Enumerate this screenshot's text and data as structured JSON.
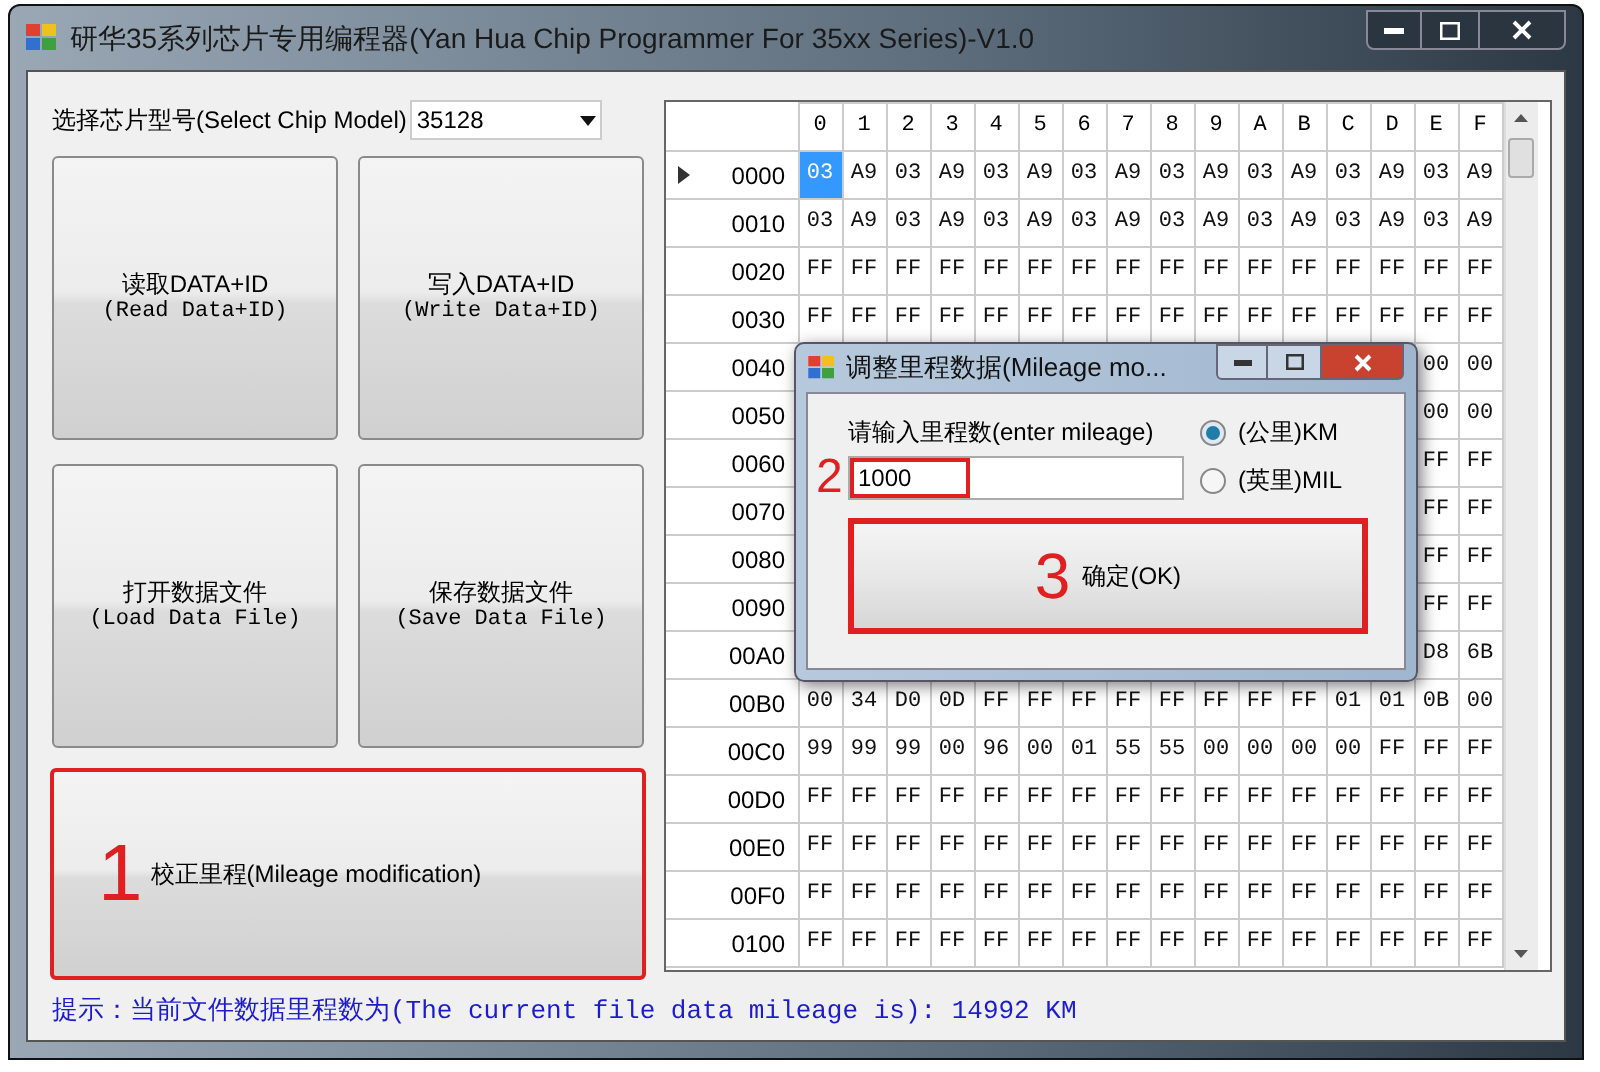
{
  "window": {
    "title": "研华35系列芯片专用编程器(Yan Hua Chip Programmer For 35xx Series)-V1.0"
  },
  "chip_select": {
    "label": "选择芯片型号(Select Chip Model)",
    "value": "35128"
  },
  "buttons": [
    {
      "label": "读取DATA+ID",
      "sublabel": "(Read Data+ID)",
      "highlighted": false
    },
    {
      "label": "写入DATA+ID",
      "sublabel": "(Write Data+ID)",
      "highlighted": false
    },
    {
      "label": "打开数据文件",
      "sublabel": "(Load Data File)",
      "highlighted": false
    },
    {
      "label": "保存数据文件",
      "sublabel": "(Save Data File)",
      "highlighted": false
    }
  ],
  "mileage_button": {
    "step": "1",
    "label": "校正里程(Mileage modification)",
    "highlighted": true
  },
  "status": "提示：当前文件数据里程数为(The current file data mileage is): 14992 KM",
  "hex_grid": {
    "columns": [
      "0",
      "1",
      "2",
      "3",
      "4",
      "5",
      "6",
      "7",
      "8",
      "9",
      "A",
      "B",
      "C",
      "D",
      "E",
      "F"
    ],
    "rows": [
      {
        "address": "0000",
        "selected": true,
        "cells": [
          {
            "text": "03",
            "selected": true
          },
          {
            "text": "A9",
            "selected": false
          },
          {
            "text": "03",
            "selected": false
          },
          {
            "text": "A9",
            "selected": false
          },
          {
            "text": "03",
            "selected": false
          },
          {
            "text": "A9",
            "selected": false
          },
          {
            "text": "03",
            "selected": false
          },
          {
            "text": "A9",
            "selected": false
          },
          {
            "text": "03",
            "selected": false
          },
          {
            "text": "A9",
            "selected": false
          },
          {
            "text": "03",
            "selected": false
          },
          {
            "text": "A9",
            "selected": false
          },
          {
            "text": "03",
            "selected": false
          },
          {
            "text": "A9",
            "selected": false
          },
          {
            "text": "03",
            "selected": false
          },
          {
            "text": "A9",
            "selected": false
          }
        ]
      },
      {
        "address": "0010",
        "selected": false,
        "cells": [
          {
            "text": "03",
            "selected": false
          },
          {
            "text": "A9",
            "selected": false
          },
          {
            "text": "03",
            "selected": false
          },
          {
            "text": "A9",
            "selected": false
          },
          {
            "text": "03",
            "selected": false
          },
          {
            "text": "A9",
            "selected": false
          },
          {
            "text": "03",
            "selected": false
          },
          {
            "text": "A9",
            "selected": false
          },
          {
            "text": "03",
            "selected": false
          },
          {
            "text": "A9",
            "selected": false
          },
          {
            "text": "03",
            "selected": false
          },
          {
            "text": "A9",
            "selected": false
          },
          {
            "text": "03",
            "selected": false
          },
          {
            "text": "A9",
            "selected": false
          },
          {
            "text": "03",
            "selected": false
          },
          {
            "text": "A9",
            "selected": false
          }
        ]
      },
      {
        "address": "0020",
        "selected": false,
        "cells": [
          {
            "text": "FF",
            "selected": false
          },
          {
            "text": "FF",
            "selected": false
          },
          {
            "text": "FF",
            "selected": false
          },
          {
            "text": "FF",
            "selected": false
          },
          {
            "text": "FF",
            "selected": false
          },
          {
            "text": "FF",
            "selected": false
          },
          {
            "text": "FF",
            "selected": false
          },
          {
            "text": "FF",
            "selected": false
          },
          {
            "text": "FF",
            "selected": false
          },
          {
            "text": "FF",
            "selected": false
          },
          {
            "text": "FF",
            "selected": false
          },
          {
            "text": "FF",
            "selected": false
          },
          {
            "text": "FF",
            "selected": false
          },
          {
            "text": "FF",
            "selected": false
          },
          {
            "text": "FF",
            "selected": false
          },
          {
            "text": "FF",
            "selected": false
          }
        ]
      },
      {
        "address": "0030",
        "selected": false,
        "cells": [
          {
            "text": "FF",
            "selected": false
          },
          {
            "text": "FF",
            "selected": false
          },
          {
            "text": "FF",
            "selected": false
          },
          {
            "text": "FF",
            "selected": false
          },
          {
            "text": "FF",
            "selected": false
          },
          {
            "text": "FF",
            "selected": false
          },
          {
            "text": "FF",
            "selected": false
          },
          {
            "text": "FF",
            "selected": false
          },
          {
            "text": "FF",
            "selected": false
          },
          {
            "text": "FF",
            "selected": false
          },
          {
            "text": "FF",
            "selected": false
          },
          {
            "text": "FF",
            "selected": false
          },
          {
            "text": "FF",
            "selected": false
          },
          {
            "text": "FF",
            "selected": false
          },
          {
            "text": "FF",
            "selected": false
          },
          {
            "text": "FF",
            "selected": false
          }
        ]
      },
      {
        "address": "0040",
        "selected": false,
        "cells": [
          null,
          null,
          null,
          null,
          null,
          null,
          null,
          null,
          null,
          null,
          null,
          null,
          null,
          null,
          {
            "text": "00",
            "selected": false
          },
          {
            "text": "00",
            "selected": false
          }
        ]
      },
      {
        "address": "0050",
        "selected": false,
        "cells": [
          null,
          null,
          null,
          null,
          null,
          null,
          null,
          null,
          null,
          null,
          null,
          null,
          null,
          null,
          {
            "text": "00",
            "selected": false
          },
          {
            "text": "00",
            "selected": false
          }
        ]
      },
      {
        "address": "0060",
        "selected": false,
        "cells": [
          null,
          null,
          null,
          null,
          null,
          null,
          null,
          null,
          null,
          null,
          null,
          null,
          null,
          null,
          {
            "text": "FF",
            "selected": false
          },
          {
            "text": "FF",
            "selected": false
          }
        ]
      },
      {
        "address": "0070",
        "selected": false,
        "cells": [
          null,
          null,
          null,
          null,
          null,
          null,
          null,
          null,
          null,
          null,
          null,
          null,
          null,
          null,
          {
            "text": "FF",
            "selected": false
          },
          {
            "text": "FF",
            "selected": false
          }
        ]
      },
      {
        "address": "0080",
        "selected": false,
        "cells": [
          null,
          null,
          null,
          null,
          null,
          null,
          null,
          null,
          null,
          null,
          null,
          null,
          null,
          null,
          {
            "text": "FF",
            "selected": false
          },
          {
            "text": "FF",
            "selected": false
          }
        ]
      },
      {
        "address": "0090",
        "selected": false,
        "cells": [
          null,
          null,
          null,
          null,
          null,
          null,
          null,
          null,
          null,
          null,
          null,
          null,
          null,
          null,
          {
            "text": "FF",
            "selected": false
          },
          {
            "text": "FF",
            "selected": false
          }
        ]
      },
      {
        "address": "00A0",
        "selected": false,
        "cells": [
          null,
          null,
          null,
          null,
          null,
          null,
          null,
          null,
          null,
          null,
          null,
          null,
          null,
          null,
          {
            "text": "D8",
            "selected": false
          },
          {
            "text": "6B",
            "selected": false
          }
        ]
      },
      {
        "address": "00B0",
        "selected": false,
        "cells": [
          {
            "text": "00",
            "selected": false
          },
          {
            "text": "34",
            "selected": false
          },
          {
            "text": "D0",
            "selected": false
          },
          {
            "text": "0D",
            "selected": false
          },
          {
            "text": "FF",
            "selected": false
          },
          {
            "text": "FF",
            "selected": false
          },
          {
            "text": "FF",
            "selected": false
          },
          {
            "text": "FF",
            "selected": false
          },
          {
            "text": "FF",
            "selected": false
          },
          {
            "text": "FF",
            "selected": false
          },
          {
            "text": "FF",
            "selected": false
          },
          {
            "text": "FF",
            "selected": false
          },
          {
            "text": "01",
            "selected": false
          },
          {
            "text": "01",
            "selected": false
          },
          {
            "text": "0B",
            "selected": false
          },
          {
            "text": "00",
            "selected": false
          }
        ]
      },
      {
        "address": "00C0",
        "selected": false,
        "cells": [
          {
            "text": "99",
            "selected": false
          },
          {
            "text": "99",
            "selected": false
          },
          {
            "text": "99",
            "selected": false
          },
          {
            "text": "00",
            "selected": false
          },
          {
            "text": "96",
            "selected": false
          },
          {
            "text": "00",
            "selected": false
          },
          {
            "text": "01",
            "selected": false
          },
          {
            "text": "55",
            "selected": false
          },
          {
            "text": "55",
            "selected": false
          },
          {
            "text": "00",
            "selected": false
          },
          {
            "text": "00",
            "selected": false
          },
          {
            "text": "00",
            "selected": false
          },
          {
            "text": "00",
            "selected": false
          },
          {
            "text": "FF",
            "selected": false
          },
          {
            "text": "FF",
            "selected": false
          },
          {
            "text": "FF",
            "selected": false
          }
        ]
      },
      {
        "address": "00D0",
        "selected": false,
        "cells": [
          {
            "text": "FF",
            "selected": false
          },
          {
            "text": "FF",
            "selected": false
          },
          {
            "text": "FF",
            "selected": false
          },
          {
            "text": "FF",
            "selected": false
          },
          {
            "text": "FF",
            "selected": false
          },
          {
            "text": "FF",
            "selected": false
          },
          {
            "text": "FF",
            "selected": false
          },
          {
            "text": "FF",
            "selected": false
          },
          {
            "text": "FF",
            "selected": false
          },
          {
            "text": "FF",
            "selected": false
          },
          {
            "text": "FF",
            "selected": false
          },
          {
            "text": "FF",
            "selected": false
          },
          {
            "text": "FF",
            "selected": false
          },
          {
            "text": "FF",
            "selected": false
          },
          {
            "text": "FF",
            "selected": false
          },
          {
            "text": "FF",
            "selected": false
          }
        ]
      },
      {
        "address": "00E0",
        "selected": false,
        "cells": [
          {
            "text": "FF",
            "selected": false
          },
          {
            "text": "FF",
            "selected": false
          },
          {
            "text": "FF",
            "selected": false
          },
          {
            "text": "FF",
            "selected": false
          },
          {
            "text": "FF",
            "selected": false
          },
          {
            "text": "FF",
            "selected": false
          },
          {
            "text": "FF",
            "selected": false
          },
          {
            "text": "FF",
            "selected": false
          },
          {
            "text": "FF",
            "selected": false
          },
          {
            "text": "FF",
            "selected": false
          },
          {
            "text": "FF",
            "selected": false
          },
          {
            "text": "FF",
            "selected": false
          },
          {
            "text": "FF",
            "selected": false
          },
          {
            "text": "FF",
            "selected": false
          },
          {
            "text": "FF",
            "selected": false
          },
          {
            "text": "FF",
            "selected": false
          }
        ]
      },
      {
        "address": "00F0",
        "selected": false,
        "cells": [
          {
            "text": "FF",
            "selected": false
          },
          {
            "text": "FF",
            "selected": false
          },
          {
            "text": "FF",
            "selected": false
          },
          {
            "text": "FF",
            "selected": false
          },
          {
            "text": "FF",
            "selected": false
          },
          {
            "text": "FF",
            "selected": false
          },
          {
            "text": "FF",
            "selected": false
          },
          {
            "text": "FF",
            "selected": false
          },
          {
            "text": "FF",
            "selected": false
          },
          {
            "text": "FF",
            "selected": false
          },
          {
            "text": "FF",
            "selected": false
          },
          {
            "text": "FF",
            "selected": false
          },
          {
            "text": "FF",
            "selected": false
          },
          {
            "text": "FF",
            "selected": false
          },
          {
            "text": "FF",
            "selected": false
          },
          {
            "text": "FF",
            "selected": false
          }
        ]
      },
      {
        "address": "0100",
        "selected": false,
        "cells": [
          {
            "text": "FF",
            "selected": false
          },
          {
            "text": "FF",
            "selected": false
          },
          {
            "text": "FF",
            "selected": false
          },
          {
            "text": "FF",
            "selected": false
          },
          {
            "text": "FF",
            "selected": false
          },
          {
            "text": "FF",
            "selected": false
          },
          {
            "text": "FF",
            "selected": false
          },
          {
            "text": "FF",
            "selected": false
          },
          {
            "text": "FF",
            "selected": false
          },
          {
            "text": "FF",
            "selected": false
          },
          {
            "text": "FF",
            "selected": false
          },
          {
            "text": "FF",
            "selected": false
          },
          {
            "text": "FF",
            "selected": false
          },
          {
            "text": "FF",
            "selected": false
          },
          {
            "text": "FF",
            "selected": false
          },
          {
            "text": "FF",
            "selected": false
          }
        ]
      }
    ]
  },
  "dialog": {
    "title": "调整里程数据(Mileage mo...",
    "prompt": "请输入里程数(enter mileage)",
    "input": {
      "step": "2",
      "value": "1000",
      "highlighted": true
    },
    "units": [
      {
        "label": "(公里)KM",
        "selected": true
      },
      {
        "label": "(英里)MIL",
        "selected": false
      }
    ],
    "ok_button": {
      "step": "3",
      "label": "确定(OK)",
      "highlighted": true
    }
  }
}
